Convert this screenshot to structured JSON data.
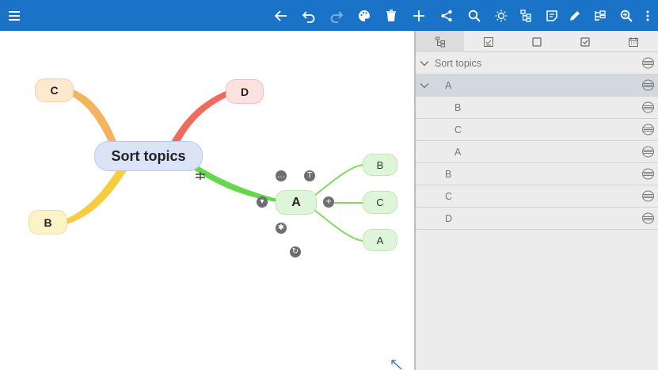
{
  "toolbar": {
    "icons": [
      "menu-icon",
      "back-arrow-icon",
      "undo-icon",
      "redo-icon",
      "palette-icon",
      "delete-icon",
      "add-icon",
      "share-icon",
      "search-icon",
      "idea-bulb-icon",
      "hierarchy-icon",
      "note-icon",
      "edit-pen-icon",
      "outline-icon",
      "zoom-icon",
      "more-vertical-icon"
    ]
  },
  "map": {
    "central": "Sort topics",
    "left_nodes": [
      "C",
      "B"
    ],
    "right_nodes": [
      "D"
    ],
    "selected": "A",
    "children": [
      "B",
      "C",
      "A"
    ]
  },
  "outline": {
    "tabs": [
      "hierarchy-tab-icon",
      "checklist-tab-icon",
      "square-tab-icon",
      "checkbox-tab-icon",
      "calendar-tab-icon"
    ],
    "rows": [
      {
        "label": "Sort topics",
        "level": 0,
        "expanded": true
      },
      {
        "label": "A",
        "level": 1,
        "expanded": true,
        "selected": true
      },
      {
        "label": "B",
        "level": 2
      },
      {
        "label": "C",
        "level": 2
      },
      {
        "label": "A",
        "level": 2
      },
      {
        "label": "B",
        "level": 1
      },
      {
        "label": "C",
        "level": 1
      },
      {
        "label": "D",
        "level": 1
      }
    ]
  },
  "colors": {
    "toolbar": "#1a73c6",
    "central_node": "#dbe3f7",
    "node_c": "#fde9d0",
    "node_d": "#fde0e0",
    "node_b": "#fdf3c8",
    "node_green": "#dff5d9",
    "link_orange": "#f4b45d",
    "link_red": "#ef6b5b",
    "link_yellow": "#f7cc3e",
    "link_green": "#63d84c"
  }
}
